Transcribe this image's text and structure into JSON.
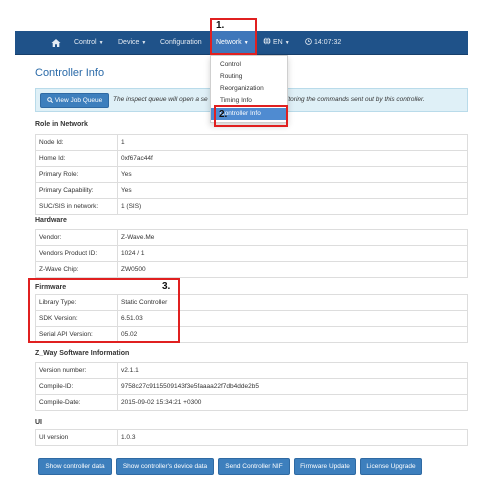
{
  "navbar": {
    "items": [
      {
        "label": "Control"
      },
      {
        "label": "Device"
      },
      {
        "label": "Configuration"
      },
      {
        "label": "Network"
      },
      {
        "label": "EN"
      }
    ],
    "clock": "14:07:32",
    "bar_color": "#1f5289",
    "active_color": "#3f77ba"
  },
  "dropdown": {
    "items": [
      {
        "label": "Control"
      },
      {
        "label": "Routing"
      },
      {
        "label": "Reorganization"
      },
      {
        "label": "Timing Info"
      },
      {
        "label": "Controller Info"
      }
    ],
    "selected": "Controller Info"
  },
  "annotations": [
    "1.",
    "2.",
    "3."
  ],
  "page_title": "Controller Info",
  "job_queue": {
    "button_label": "View Job Queue",
    "info_text_left": "The inspect queue will open a se",
    "info_text_right": "onitoring the commands sent out by this controller."
  },
  "sections": {
    "role": {
      "title": "Role in Network",
      "rows": [
        {
          "key": "Node Id:",
          "value": "1"
        },
        {
          "key": "Home Id:",
          "value": "0xf67ac44f"
        },
        {
          "key": "Primary Role:",
          "value": "Yes"
        },
        {
          "key": "Primary Capability:",
          "value": "Yes"
        },
        {
          "key": "SUC/SIS in network:",
          "value": "1 (SIS)"
        }
      ]
    },
    "hardware": {
      "title": "Hardware",
      "rows": [
        {
          "key": "Vendor:",
          "value": "Z-Wave.Me"
        },
        {
          "key": "Vendors Product ID:",
          "value": "1024 / 1"
        },
        {
          "key": "Z-Wave Chip:",
          "value": "ZW0500"
        }
      ]
    },
    "firmware": {
      "title": "Firmware",
      "rows": [
        {
          "key": "Library Type:",
          "value": "Static Controller"
        },
        {
          "key": "SDK Version:",
          "value": "6.51.03"
        },
        {
          "key": "Serial API Version:",
          "value": "05.02"
        }
      ]
    },
    "zway": {
      "title": "Z_Way Software Information",
      "rows": [
        {
          "key": "Version number:",
          "value": "v2.1.1"
        },
        {
          "key": "Compile-ID:",
          "value": "9758c27c9115509143f3e5faaaa22f7db4dde2b5"
        },
        {
          "key": "Compile-Date:",
          "value": "2015-09-02 15:34:21 +0300"
        }
      ]
    },
    "ui": {
      "title": "UI",
      "rows": [
        {
          "key": "UI version",
          "value": "1.0.3"
        }
      ]
    }
  },
  "buttons": {
    "show_data": "Show controller data",
    "show_device_data": "Show controller's device data",
    "send_nif": "Send Controller NIF",
    "firmware_update": "Firmware Update",
    "license_upgrade": "License Upgrade",
    "color": "#3d7fbd"
  }
}
